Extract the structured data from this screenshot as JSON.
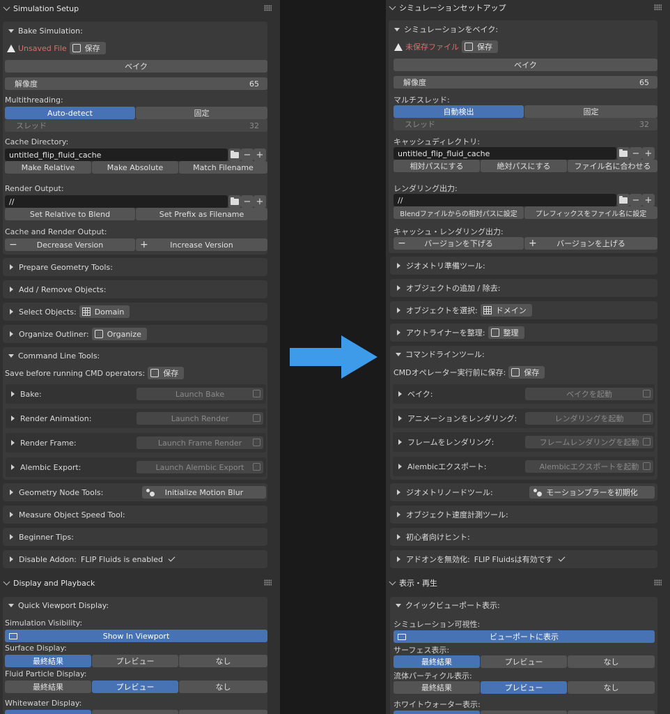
{
  "left": {
    "sim_setup_title": "Simulation Setup",
    "bake_sim_title": "Bake Simulation:",
    "unsaved_file": "Unsaved File",
    "save": "保存",
    "bake": "ベイク",
    "resolution_label": "解像度",
    "resolution_value": "65",
    "multithreading": "Multithreading:",
    "auto_detect": "Auto-detect",
    "fixed": "固定",
    "threads_label": "スレッド",
    "threads_value": "32",
    "cache_dir": "Cache Directory:",
    "cache_path": "untitled_flip_fluid_cache",
    "make_relative": "Make Relative",
    "make_absolute": "Make Absolute",
    "match_filename": "Match Filename",
    "render_output": "Render Output:",
    "render_path": "//",
    "set_relative_blend": "Set Relative to Blend",
    "set_prefix_filename": "Set Prefix as Filename",
    "cache_render_output": "Cache and Render Output:",
    "decrease_version": "Decrease Version",
    "increase_version": "Increase Version",
    "prepare_geometry": "Prepare Geometry Tools:",
    "add_remove": "Add / Remove Objects:",
    "select_objects": "Select Objects:",
    "domain": "Domain",
    "organize_outliner": "Organize Outliner:",
    "organize": "Organize",
    "command_line_tools": "Command Line Tools:",
    "save_before_cmd": "Save before running CMD operators:",
    "cmd_bake": "Bake:",
    "launch_bake": "Launch Bake",
    "render_animation": "Render Animation:",
    "launch_render": "Launch Render",
    "render_frame": "Render Frame:",
    "launch_frame_render": "Launch Frame Render",
    "alembic_export": "Alembic Export:",
    "launch_alembic": "Launch Alembic Export",
    "geometry_node_tools": "Geometry Node Tools:",
    "init_motion_blur": "Initialize Motion Blur",
    "measure_speed": "Measure Object Speed Tool:",
    "beginner_tips": "Beginner Tips:",
    "disable_addon": "Disable Addon:",
    "flip_enabled": "FLIP Fluids is enabled",
    "display_playback": "Display and Playback",
    "quick_viewport": "Quick Viewport Display:",
    "sim_visibility": "Simulation Visibility:",
    "show_in_viewport": "Show In Viewport",
    "surface_display": "Surface Display:",
    "final": "最終結果",
    "preview": "プレビュー",
    "none": "なし",
    "fluid_particle_display": "Fluid Particle Display:",
    "whitewater_display": "Whitewater Display:"
  },
  "right": {
    "sim_setup_title": "シミュレーションセットアップ",
    "bake_sim_title": "シミュレーションをベイク:",
    "unsaved_file": "未保存ファイル",
    "save": "保存",
    "bake": "ベイク",
    "resolution_label": "解像度",
    "resolution_value": "65",
    "multithreading": "マルチスレッド:",
    "auto_detect": "自動検出",
    "fixed": "固定",
    "threads_label": "スレッド",
    "threads_value": "32",
    "cache_dir": "キャッシュディレクトリ:",
    "cache_path": "untitled_flip_fluid_cache",
    "make_relative": "相対パスにする",
    "make_absolute": "絶対パスにする",
    "match_filename": "ファイル名に合わせる",
    "render_output": "レンダリング出力:",
    "render_path": "//",
    "set_relative_blend": "Blendファイルからの相対パスに設定",
    "set_prefix_filename": "プレフィックスをファイル名に設定",
    "cache_render_output": "キャッシュ・レンダリング出力:",
    "decrease_version": "バージョンを下げる",
    "increase_version": "バージョンを上げる",
    "prepare_geometry": "ジオメトリ準備ツール:",
    "add_remove": "オブジェクトの追加 / 除去:",
    "select_objects": "オブジェクトを選択:",
    "domain": "ドメイン",
    "organize_outliner": "アウトライナーを整理:",
    "organize": "整理",
    "command_line_tools": "コマンドラインツール:",
    "save_before_cmd": "CMDオペレーター実行前に保存:",
    "cmd_bake": "ベイク:",
    "launch_bake": "ベイクを起動",
    "render_animation": "アニメーションをレンダリング:",
    "launch_render": "レンダリングを起動",
    "render_frame": "フレームをレンダリング:",
    "launch_frame_render": "フレームレンダリングを起動",
    "alembic_export": "Alembicエクスポート:",
    "launch_alembic": "Alembicエクスポートを起動",
    "geometry_node_tools": "ジオメトリノードツール:",
    "init_motion_blur": "モーションブラーを初期化",
    "measure_speed": "オブジェクト速度計測ツール:",
    "beginner_tips": "初心者向けヒント:",
    "disable_addon": "アドオンを無効化:",
    "flip_enabled": "FLIP Fluidsは有効です",
    "display_playback": "表示・再生",
    "quick_viewport": "クイックビューポート表示:",
    "sim_visibility": "シミュレーション可視性:",
    "show_in_viewport": "ビューポートに表示",
    "surface_display": "サーフェス表示:",
    "final": "最終結果",
    "preview": "プレビュー",
    "none": "なし",
    "fluid_particle_display": "流体パーティクル表示:",
    "whitewater_display": "ホワイトウォーター表示:"
  },
  "colors": {
    "accent": "#4772b3",
    "arrow": "#3d9be9",
    "warning": "#e06c6c"
  }
}
